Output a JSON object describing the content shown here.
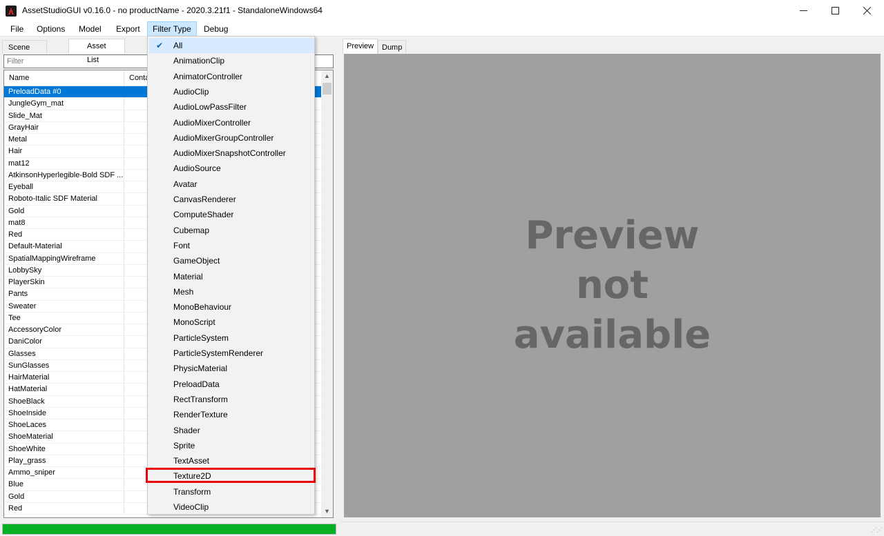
{
  "window": {
    "title": "AssetStudioGUI v0.16.0 - no productName - 2020.3.21f1 - StandaloneWindows64",
    "minimize_icon": "minimize-icon",
    "maximize_icon": "maximize-icon",
    "close_icon": "close-icon"
  },
  "menu": [
    "File",
    "Options",
    "Model",
    "Export",
    "Filter Type",
    "Debug"
  ],
  "left": {
    "tabs": [
      "Scene Hierarchy",
      "Asset List"
    ],
    "filter_placeholder": "Filter",
    "columns": [
      "Name",
      "Conta"
    ],
    "rows": [
      "PreloadData #0",
      "JungleGym_mat",
      "Slide_Mat",
      "GrayHair",
      "Metal",
      "Hair",
      "mat12",
      "AtkinsonHyperlegible-Bold SDF ...",
      "Eyeball",
      "Roboto-Italic SDF Material",
      "Gold",
      "mat8",
      "Red",
      "Default-Material",
      "SpatialMappingWireframe",
      "LobbySky",
      "PlayerSkin",
      "Pants",
      "Sweater",
      "Tee",
      "AccessoryColor",
      "DaniColor",
      "Glasses",
      "SunGlasses",
      "HairMaterial",
      "HatMaterial",
      "ShoeBlack",
      "ShoeInside",
      "ShoeLaces",
      "ShoeMaterial",
      "ShoeWhite",
      "Play_grass",
      "Ammo_sniper",
      "Blue",
      "Gold",
      "Red"
    ]
  },
  "right": {
    "tabs": [
      "Preview",
      "Dump"
    ],
    "preview_message": "Preview not available"
  },
  "filter_menu": {
    "items": [
      "All",
      "AnimationClip",
      "AnimatorController",
      "AudioClip",
      "AudioLowPassFilter",
      "AudioMixerController",
      "AudioMixerGroupController",
      "AudioMixerSnapshotController",
      "AudioSource",
      "Avatar",
      "CanvasRenderer",
      "ComputeShader",
      "Cubemap",
      "Font",
      "GameObject",
      "Material",
      "Mesh",
      "MonoBehaviour",
      "MonoScript",
      "ParticleSystem",
      "ParticleSystemRenderer",
      "PhysicMaterial",
      "PreloadData",
      "RectTransform",
      "RenderTexture",
      "Shader",
      "Sprite",
      "TextAsset",
      "Texture2D",
      "Transform",
      "VideoClip"
    ],
    "checked": "All",
    "highlighted": "Texture2D"
  },
  "status": {
    "progress": 1.0,
    "progress_color": "#06b025"
  },
  "colors": {
    "selection": "#0078d7",
    "highlight_box": "#e8000b",
    "preview_bg": "#a0a0a0"
  }
}
